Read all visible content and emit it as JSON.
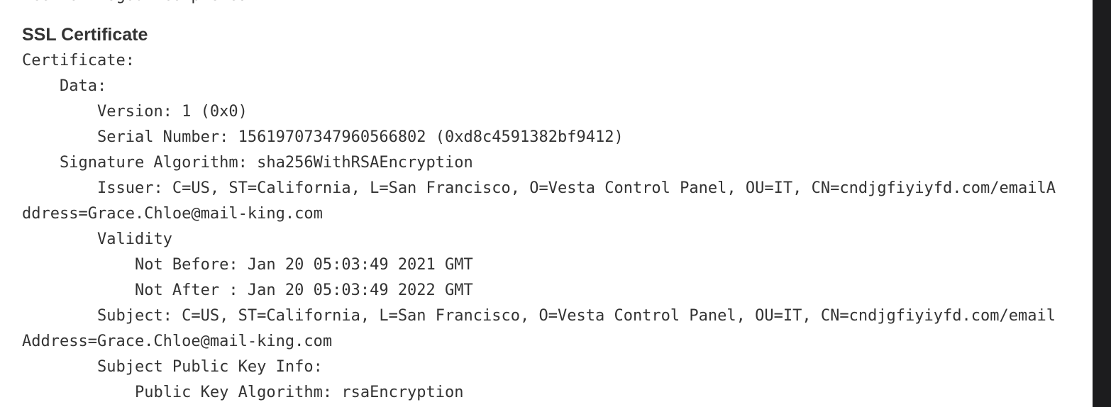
{
  "previous_output_tail": "Ace: OK Logout completed.",
  "ssl_certificate": {
    "heading": "SSL Certificate",
    "text": "Certificate:\n    Data:\n        Version: 1 (0x0)\n        Serial Number: 15619707347960566802 (0xd8c4591382bf9412)\n    Signature Algorithm: sha256WithRSAEncryption\n        Issuer: C=US, ST=California, L=San Francisco, O=Vesta Control Panel, OU=IT, CN=cndjgfiyiyfd.com/emailAddress=Grace.Chloe@mail-king.com\n        Validity\n            Not Before: Jan 20 05:03:49 2021 GMT\n            Not After : Jan 20 05:03:49 2022 GMT\n        Subject: C=US, ST=California, L=San Francisco, O=Vesta Control Panel, OU=IT, CN=cndjgfiyiyfd.com/emailAddress=Grace.Chloe@mail-king.com\n        Subject Public Key Info:\n            Public Key Algorithm: rsaEncryption"
  }
}
